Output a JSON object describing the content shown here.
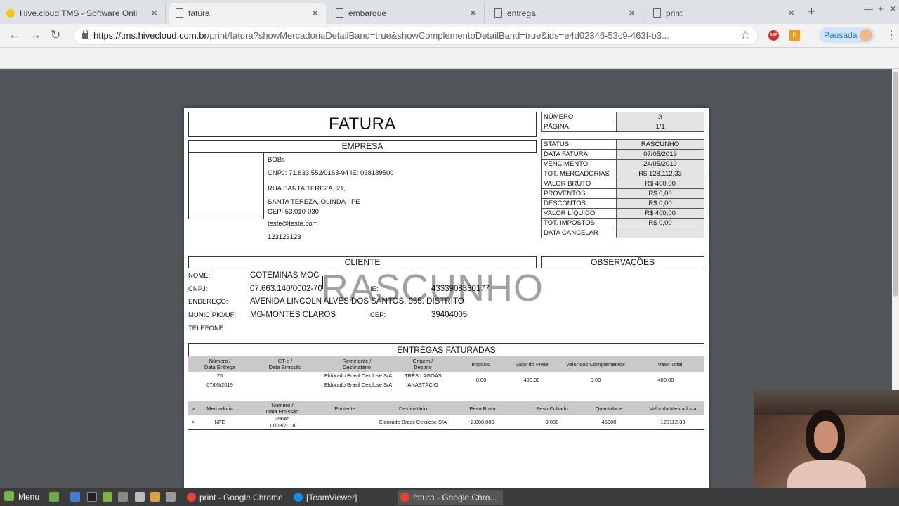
{
  "browser": {
    "tabs": [
      {
        "title": "Hive.cloud TMS - Software Onli",
        "icon": "hive-icon",
        "active": false
      },
      {
        "title": "fatura",
        "icon": "document-icon",
        "active": true
      },
      {
        "title": "embarque",
        "icon": "document-icon",
        "active": false
      },
      {
        "title": "entrega",
        "icon": "document-icon",
        "active": false
      },
      {
        "title": "print",
        "icon": "document-icon",
        "active": false
      }
    ],
    "url_host": "https://tms.hivecloud.com.br",
    "url_rest": "/print/fatura?showMercadoriaDetailBand=true&showComplementoDetailBand=true&ids=e4d02346-53c9-463f-b3...",
    "paused_label": "Pausada",
    "extensions": {
      "abp": "ABP",
      "h": "h"
    }
  },
  "invoice": {
    "title": "FATURA",
    "empresa_header": "EMPRESA",
    "company": {
      "name": "BOBs",
      "cnpj_ie": "CNPJ: 71.833.552/0163-94 IE: 038189500",
      "street": "RUA SANTA TEREZA, 21,",
      "city": "SANTA TEREZA, OLINDA - PE",
      "cep": "CEP: 53.010-030",
      "email": "teste@teste.com",
      "phone": "123123123"
    },
    "top_info": [
      {
        "label": "NÚMERO",
        "value": "3"
      },
      {
        "label": "PÁGINA",
        "value": "1/1"
      }
    ],
    "status_info": [
      {
        "label": "STATUS",
        "value": "RASCUNHO"
      },
      {
        "label": "DATA FATURA",
        "value": "07/05/2019"
      },
      {
        "label": "VENCIMENTO",
        "value": "24/05/2019"
      },
      {
        "label": "TOT. MERCADORIAS",
        "value": "R$ 128.112,33"
      },
      {
        "label": "VALOR BRUTO",
        "value": "R$ 400,00"
      },
      {
        "label": "PROVENTOS",
        "value": "R$ 0,00"
      },
      {
        "label": "DESCONTOS",
        "value": "R$ 0,00"
      },
      {
        "label": "VALOR LÍQUIDO",
        "value": "R$ 400,00"
      },
      {
        "label": "TOT. IMPOSTOS",
        "value": "R$ 0,00"
      },
      {
        "label": "DATA CANCELAR",
        "value": ""
      }
    ],
    "cliente_header": "CLIENTE",
    "observacoes_header": "OBSERVAÇÕES",
    "cliente": {
      "nome_label": "NOME:",
      "nome": "COTEMINAS MOC",
      "cnpj_label": "CNPJ:",
      "cnpj": "07.663.140/0002-70",
      "ie_label": "IE:",
      "ie": "4333908330177",
      "endereco_label": "ENDEREÇO:",
      "endereco": "AVENIDA LINCOLN ALVES DOS SANTOS, 955. DISTRITO",
      "municipio_label": "MUNICÍPIO/UF:",
      "municipio": "MG-MONTES CLAROS",
      "cep_label": "CEP:",
      "cep": "39404005",
      "telefone_label": "TELEFONE:"
    },
    "watermark": "RASCUNHO",
    "entregas_header": "ENTREGAS FATURADAS",
    "entregas_columns": [
      {
        "l1": "Número /",
        "l2": "Data Entrega"
      },
      {
        "l1": "CT-e /",
        "l2": "Data Emissão"
      },
      {
        "l1": "Remetente /",
        "l2": "Destinatário"
      },
      {
        "l1": "Origem /",
        "l2": "Destino"
      },
      {
        "l1": "Imposto",
        "l2": ""
      },
      {
        "l1": "Valor do Frete",
        "l2": ""
      },
      {
        "l1": "Valor dos Complementos",
        "l2": ""
      },
      {
        "l1": "Valor Total",
        "l2": ""
      }
    ],
    "entrega_row": {
      "numero": "75",
      "data_entrega": "07/05/2019",
      "remetente": "Eldorado Brasil Celulose S/A",
      "destinatario": "Eldorado Brasil Celulose S/A",
      "origem": "TRÊS LAGOAS",
      "destino": "ANASTÁCIO",
      "imposto": "0,00",
      "frete": "400,00",
      "complementos": "0,00",
      "total": "400,00"
    },
    "mercadoria_columns": [
      {
        "l1": ">",
        "l2": ""
      },
      {
        "l1": "Mercadoria",
        "l2": ""
      },
      {
        "l1": "Número /",
        "l2": "Data Emissão"
      },
      {
        "l1": "Emitente",
        "l2": ""
      },
      {
        "l1": "Destinatário",
        "l2": ""
      },
      {
        "l1": "Peso Bruto",
        "l2": ""
      },
      {
        "l1": "Peso Cubado",
        "l2": ""
      },
      {
        "l1": "Quantidade",
        "l2": ""
      },
      {
        "l1": "Valor da Mercadoria",
        "l2": ""
      }
    ],
    "mercadoria_row": {
      "marker": ">",
      "mercadoria": "NFE",
      "numero": "39645",
      "data": "11/03/2018",
      "emitente": "",
      "destinatario": "Eldorado Brasil Celulose S/A",
      "peso_bruto": "2.000,000",
      "peso_cubado": "0,000",
      "quantidade": "45000",
      "valor": "128112,33"
    }
  },
  "taskbar": {
    "menu_label": "Menu",
    "items": [
      {
        "label": "print - Google Chrome",
        "active": false
      },
      {
        "label": "[TeamViewer]",
        "active": false
      },
      {
        "label": "fatura - Google Chro...",
        "active": true
      }
    ]
  }
}
